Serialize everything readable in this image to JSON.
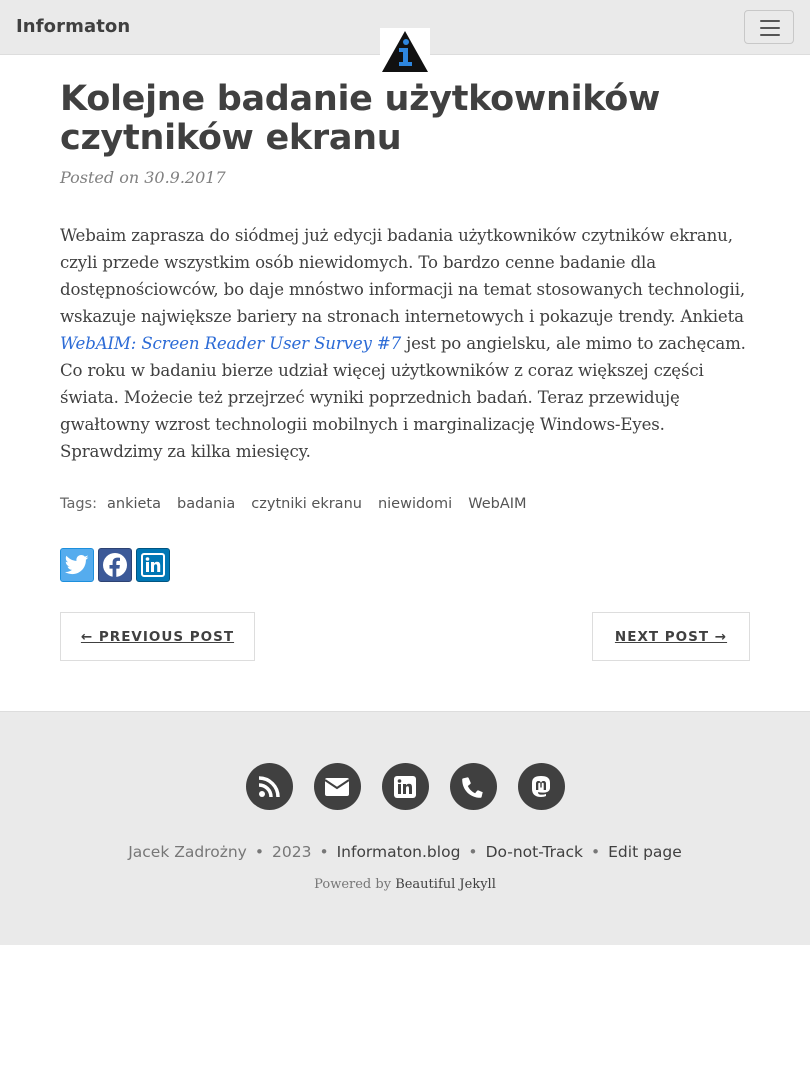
{
  "navbar": {
    "brand": "Informaton",
    "menu_icon": "hamburger-icon",
    "logo_icon": "info-triangle-logo"
  },
  "post": {
    "title": "Kolejne badanie użytkowników czytników ekranu",
    "posted_prefix": "Posted on",
    "date": "30.9.2017",
    "body_before_link": "Webaim zaprasza do siódmej już edycji badania użytkowników czytników ekranu, czyli przede wszystkim osób niewidomych. To bardzo cenne badanie dla dostępnościowców, bo daje mnóstwo informacji na temat stosowanych technologii, wskazuje największe bariery na stronach internetowych i pokazuje trendy. Ankieta ",
    "link_text": "WebAIM: Screen Reader User Survey #7",
    "body_after_link": " jest po angielsku, ale mimo to zachęcam. Co roku w badaniu bierze udział więcej użytkowników z coraz większej części świata. Możecie też przejrzeć wyniki poprzednich badań. Teraz przewiduję gwałtowny wzrost technologii mobilnych i marginalizację Windows-Eyes. Sprawdzimy za kilka miesięcy."
  },
  "tags": {
    "label": "Tags:",
    "items": [
      "ankieta",
      "badania",
      "czytniki ekranu",
      "niewidomi",
      "WebAIM"
    ]
  },
  "share": {
    "icons": [
      "twitter-icon",
      "facebook-icon",
      "linkedin-icon"
    ],
    "colors": {
      "twitter": "#55acee",
      "facebook": "#3b5998",
      "linkedin": "#0077b5"
    }
  },
  "pager": {
    "previous": "← Previous Post",
    "next": "Next Post →"
  },
  "footer": {
    "social_icons": [
      "rss-icon",
      "envelope-icon",
      "linkedin-icon",
      "phone-icon",
      "mastodon-icon"
    ],
    "author": "Jacek Zadrożny",
    "year": "2023",
    "site": "Informaton.blog",
    "dnt": "Do-not-Track",
    "edit": "Edit page",
    "powered_prefix": "Powered by",
    "powered_link": "Beautiful Jekyll"
  }
}
